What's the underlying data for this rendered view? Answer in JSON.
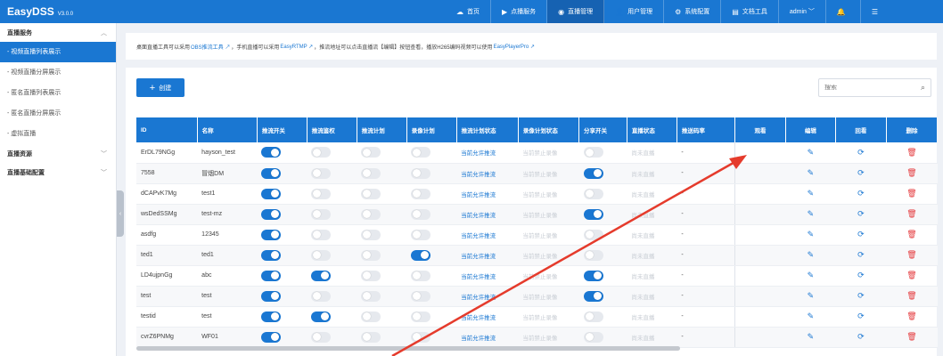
{
  "app": {
    "name": "EasyDSS",
    "version": "V3.0.0"
  },
  "nav": [
    {
      "icon": "☁",
      "icon_name": "cloud-icon",
      "label": "首页",
      "active": false
    },
    {
      "icon": "▶",
      "icon_name": "video-icon",
      "label": "点播服务",
      "active": false
    },
    {
      "icon": "◉",
      "icon_name": "live-icon",
      "label": "直播管理",
      "active": true
    },
    {
      "icon": "👤",
      "icon_name": "user-icon",
      "label": "用户管理",
      "active": false
    },
    {
      "icon": "⚙",
      "icon_name": "gear-icon",
      "label": "系统配置",
      "active": false
    },
    {
      "icon": "▤",
      "icon_name": "doc-icon",
      "label": "文档工具",
      "active": false
    },
    {
      "icon": "",
      "icon_name": "",
      "label": "admin ﹀",
      "active": false
    },
    {
      "icon": "🔔",
      "icon_name": "bell-icon",
      "label": "",
      "active": false
    },
    {
      "icon": "☰",
      "icon_name": "menu-icon",
      "label": "",
      "active": false
    }
  ],
  "sidebar": {
    "group1": "直播服务",
    "items": [
      "- 视频直播列表展示",
      "- 视频直播分屏展示",
      "- 匿名直播列表展示",
      "- 匿名直播分屏展示",
      "- 虚拟直播"
    ],
    "group2": "直播资源",
    "group3": "直播基础配置"
  },
  "notice": {
    "t1": "桌面直播工具可以采用",
    "l1": "OBS推流工具 ↗",
    "t2": "，手机直播可以采用",
    "l2": "EasyRTMP ↗",
    "t3": "，推流地址可以点击直播流【编辑】按钮查看，播放H265编码视频可以使用",
    "l3": "EasyPlayerPro ↗"
  },
  "toolbar": {
    "create_label": "创建",
    "search_placeholder": "搜索"
  },
  "table": {
    "headers": [
      "ID",
      "名称",
      "推流开关",
      "推流鉴权",
      "推流计划",
      "录像计划",
      "推流计划状态",
      "录像计划状态",
      "分享开关",
      "直播状态",
      "推送码率",
      "观看",
      "编辑",
      "回看",
      "删除"
    ],
    "rows": [
      {
        "id": "ErDL79NGg",
        "name": "hayson_test",
        "push": true,
        "auth": false,
        "plan": false,
        "rec": false,
        "push_status": "当前允许推流",
        "rec_status": "当前禁止录像",
        "share": false,
        "live": "尚未直播",
        "rate": "-"
      },
      {
        "id": "7558",
        "name": "冒烟DM",
        "push": true,
        "auth": false,
        "plan": false,
        "rec": false,
        "push_status": "当前允许推流",
        "rec_status": "当前禁止录像",
        "share": true,
        "live": "尚未直播",
        "rate": "-"
      },
      {
        "id": "dCAPvK7Mg",
        "name": "test1",
        "push": true,
        "auth": false,
        "plan": false,
        "rec": false,
        "push_status": "当前允许推流",
        "rec_status": "当前禁止录像",
        "share": false,
        "live": "尚未直播",
        "rate": "-"
      },
      {
        "id": "wsDedSSMg",
        "name": "test-mz",
        "push": true,
        "auth": false,
        "plan": false,
        "rec": false,
        "push_status": "当前允许推流",
        "rec_status": "当前禁止录像",
        "share": true,
        "live": "尚未直播",
        "rate": "-"
      },
      {
        "id": "asdfg",
        "name": "12345",
        "push": true,
        "auth": false,
        "plan": false,
        "rec": false,
        "push_status": "当前允许推流",
        "rec_status": "当前禁止录像",
        "share": false,
        "live": "尚未直播",
        "rate": "-"
      },
      {
        "id": "ted1",
        "name": "ted1",
        "push": true,
        "auth": false,
        "plan": false,
        "rec": true,
        "push_status": "当前允许推流",
        "rec_status": "当前禁止录像",
        "share": false,
        "live": "尚未直播",
        "rate": "-"
      },
      {
        "id": "LD4ujpnGg",
        "name": "abc",
        "push": true,
        "auth": true,
        "plan": false,
        "rec": false,
        "push_status": "当前允许推流",
        "rec_status": "当前禁止录像",
        "share": true,
        "live": "尚未直播",
        "rate": "-"
      },
      {
        "id": "test",
        "name": "test",
        "push": true,
        "auth": false,
        "plan": false,
        "rec": false,
        "push_status": "当前允许推流",
        "rec_status": "当前禁止录像",
        "share": true,
        "live": "尚未直播",
        "rate": "-"
      },
      {
        "id": "testid",
        "name": "test",
        "push": true,
        "auth": true,
        "plan": false,
        "rec": false,
        "push_status": "当前允许推流",
        "rec_status": "当前禁止录像",
        "share": false,
        "live": "尚未直播",
        "rate": "-"
      },
      {
        "id": "cvrZ6PNMg",
        "name": "WF01",
        "push": true,
        "auth": false,
        "plan": false,
        "rec": false,
        "push_status": "当前允许推流",
        "rec_status": "当前禁止录像",
        "share": false,
        "live": "尚未直播",
        "rate": "-"
      }
    ]
  },
  "icons": {
    "edit": "edit-icon",
    "replay": "replay-icon",
    "delete": "trash-icon"
  },
  "colors": {
    "primary": "#1a77d2",
    "danger": "#e4393c",
    "annotation_arrow": "#e53b2c"
  }
}
